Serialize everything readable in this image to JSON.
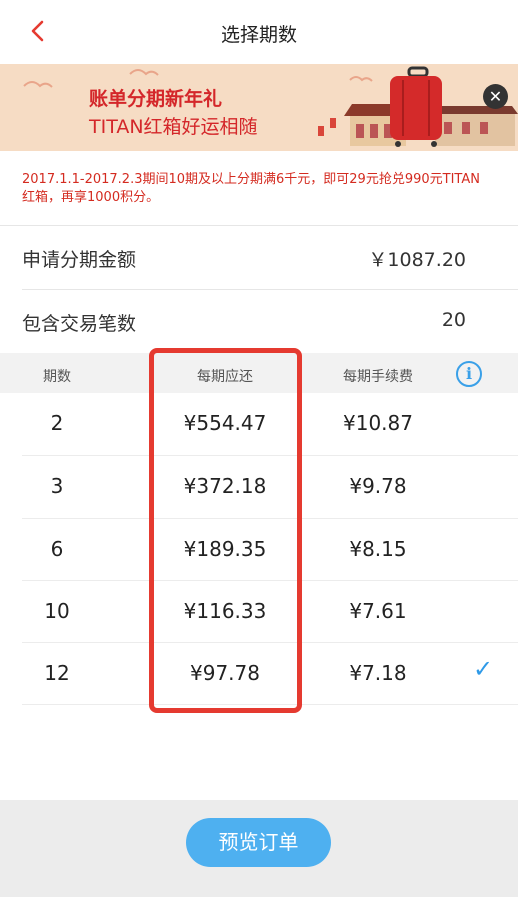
{
  "nav": {
    "title": "选择期数",
    "back_icon": "chevron-left-icon"
  },
  "banner": {
    "title": "账单分期新年礼",
    "subtitle": "TITAN红箱好运相随",
    "close_icon": "close-icon"
  },
  "promo": {
    "text": "2017.1.1-2017.2.3期间10期及以上分期满6千元，即可29元抢兑990元TITAN红箱，再享1000积分。"
  },
  "summary": {
    "amount_label": "申请分期金额",
    "amount_value": "￥1087.20",
    "count_label": "包含交易笔数",
    "count_value": "20"
  },
  "table": {
    "headers": {
      "periods": "期数",
      "payment": "每期应还",
      "fee": "每期手续费"
    },
    "info_icon": "info-icon",
    "rows": [
      {
        "periods": "2",
        "payment": "¥554.47",
        "fee": "¥10.87",
        "selected": false
      },
      {
        "periods": "3",
        "payment": "¥372.18",
        "fee": "¥9.78",
        "selected": false
      },
      {
        "periods": "6",
        "payment": "¥189.35",
        "fee": "¥8.15",
        "selected": false
      },
      {
        "periods": "10",
        "payment": "¥116.33",
        "fee": "¥7.61",
        "selected": false
      },
      {
        "periods": "12",
        "payment": "¥97.78",
        "fee": "¥7.18",
        "selected": true
      }
    ],
    "check_glyph": "✓"
  },
  "footer": {
    "preview_label": "预览订单"
  },
  "colors": {
    "accent_blue": "#4eb0f0",
    "highlight_red": "#e53a30",
    "promo_red": "#d42b20"
  }
}
